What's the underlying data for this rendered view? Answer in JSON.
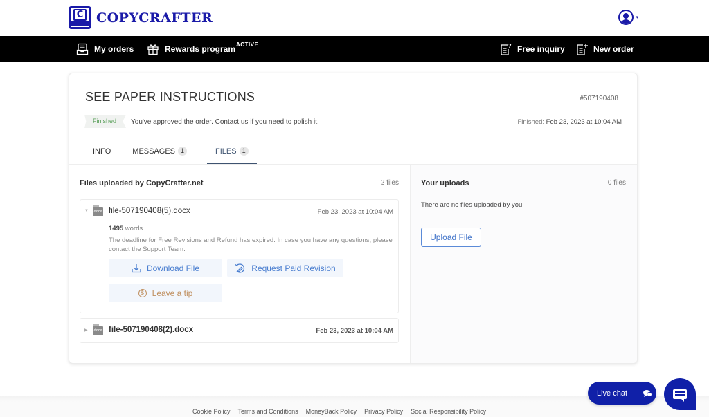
{
  "header": {
    "logo_letter": "C",
    "brand": "COPYCRAFTER",
    "user_caret": "▾"
  },
  "nav": {
    "my_orders": "My orders",
    "rewards": "Rewards program",
    "rewards_badge": "ACTIVE",
    "free_inquiry": "Free inquiry",
    "new_order": "New order"
  },
  "order": {
    "title": "SEE PAPER INSTRUCTIONS",
    "id": "#507190408",
    "status": "Finished",
    "status_message": "You've approved the order. Contact us if you need to polish it.",
    "finished_label": "Finished:",
    "finished_date": "Feb 23, 2023 at 10:04 AM"
  },
  "tabs": [
    {
      "label": "INFO",
      "count": null
    },
    {
      "label": "MESSAGES",
      "count": "1"
    },
    {
      "label": "FILES",
      "count": "1",
      "active": true
    }
  ],
  "files_section": {
    "title": "Files uploaded by CopyCrafter.net",
    "count": "2 files",
    "files": [
      {
        "icon_label": "docx",
        "name": "file-507190408(5).docx",
        "date": "Feb 23, 2023 at 10:04 AM",
        "words_count": "1495",
        "words_label": "words",
        "notice": "The deadline for Free Revisions and Refund has expired. In case you have any questions, please contact the Support Team.",
        "download_label": "Download File",
        "revision_label": "Request Paid Revision",
        "tip_label": "Leave a tip",
        "expanded": true
      },
      {
        "icon_label": "docx",
        "name": "file-507190408(2).docx",
        "date": "Feb 23, 2023 at 10:04 AM",
        "expanded": false
      }
    ]
  },
  "uploads_section": {
    "title": "Your uploads",
    "count": "0 files",
    "empty_text": "There are no files uploaded by you",
    "upload_label": "Upload File"
  },
  "footer": {
    "links": [
      "Cookie Policy",
      "Terms and Conditions",
      "MoneyBack Policy",
      "Privacy Policy",
      "Social Responsibility Policy"
    ]
  },
  "chat": {
    "live_chat_label": "Live chat"
  },
  "colors": {
    "brand": "#1a1aa8",
    "chat": "#1020a8",
    "link_blue": "#4a7ed0",
    "tip": "#c09060",
    "status_green": "#5aa05a",
    "active_tab": "#3e5370"
  }
}
